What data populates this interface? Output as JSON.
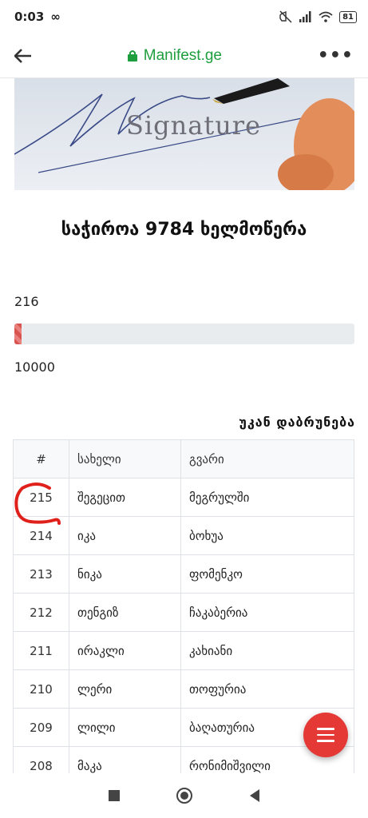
{
  "status": {
    "time": "0:03",
    "link_glyph": "∞",
    "battery": "81"
  },
  "browser": {
    "url": "Manifest.ge"
  },
  "hero": {
    "image_text": "Signature"
  },
  "petition": {
    "title": "საჭიროა 9784 ხელმოწერა",
    "signed_count": "216",
    "goal": "10000",
    "progress_fraction": 0.0216
  },
  "back_link": "უკან დაბრუნება",
  "table": {
    "headers": [
      "#",
      "სახელი",
      "გვარი"
    ],
    "rows": [
      {
        "num": "215",
        "name": "შეგეცით",
        "surname": "მეგრულში"
      },
      {
        "num": "214",
        "name": "იკა",
        "surname": "ბოხუა"
      },
      {
        "num": "213",
        "name": "ნიკა",
        "surname": "ფომენკო"
      },
      {
        "num": "212",
        "name": "თენგიზ",
        "surname": "ჩაკაბერია"
      },
      {
        "num": "211",
        "name": "ირაკლი",
        "surname": "კახიანი"
      },
      {
        "num": "210",
        "name": "ლერი",
        "surname": "თოფურია"
      },
      {
        "num": "209",
        "name": "ლილი",
        "surname": "ბაღათურია"
      },
      {
        "num": "208",
        "name": "მაკა",
        "surname": "რონიმიშვილი"
      }
    ]
  },
  "colors": {
    "accent_green": "#1e9e3e",
    "progress_red": "#d9534f",
    "fab_red": "#e53935",
    "annotation_red": "#e0201a"
  }
}
